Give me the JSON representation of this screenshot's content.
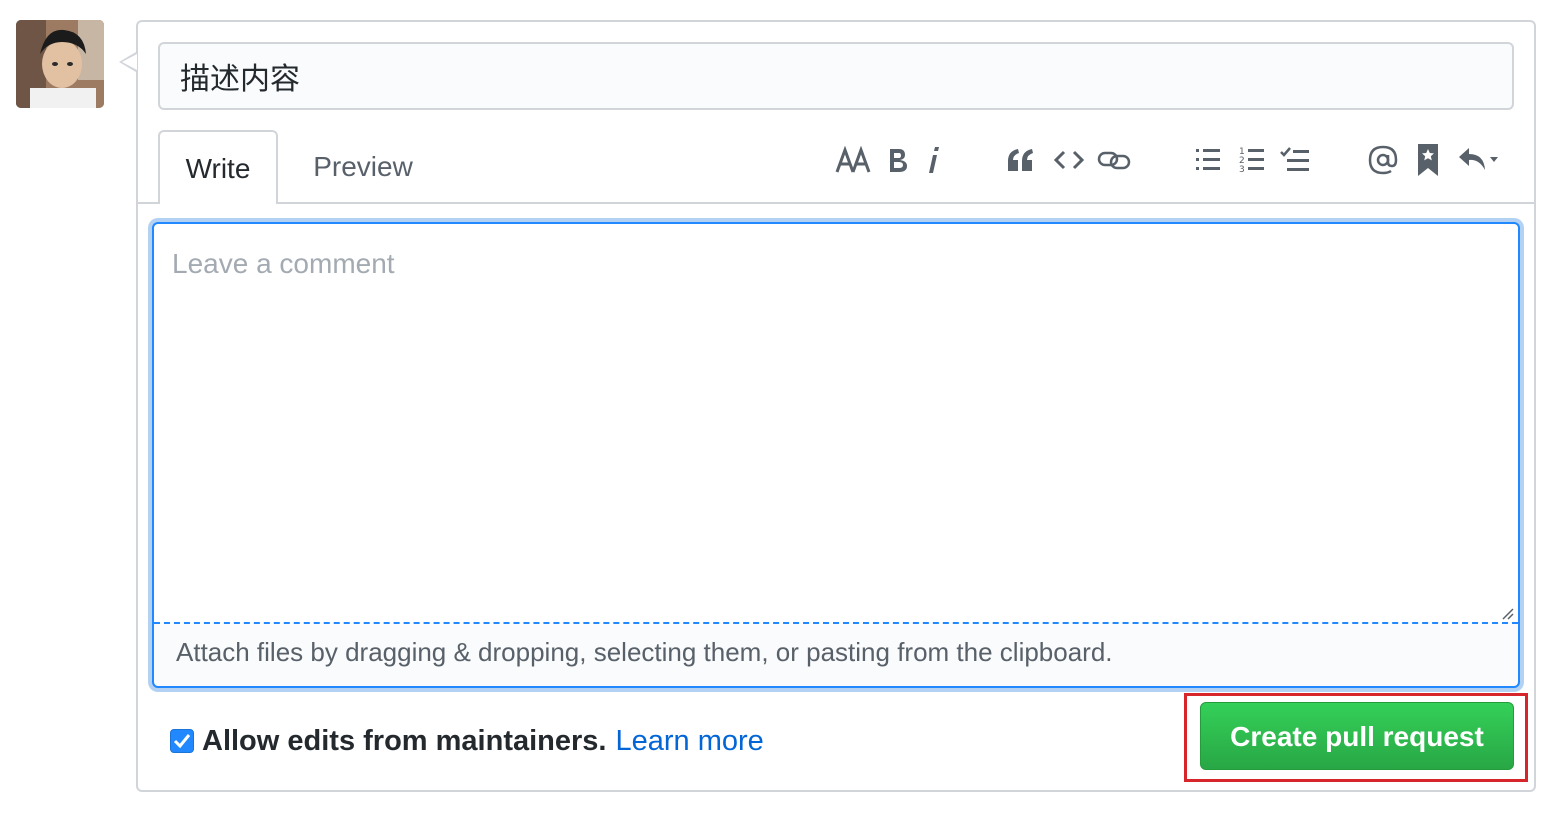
{
  "title_input": {
    "value": "描述内容"
  },
  "tabs": [
    {
      "label": "Write",
      "active": true
    },
    {
      "label": "Preview",
      "active": false
    }
  ],
  "toolbar": {
    "icons": [
      "text-size-icon",
      "bold-icon",
      "italic-icon",
      "quote-icon",
      "code-icon",
      "link-icon",
      "unordered-list-icon",
      "ordered-list-icon",
      "task-list-icon",
      "mention-icon",
      "saved-reply-icon",
      "reply-icon"
    ]
  },
  "comment": {
    "placeholder": "Leave a comment",
    "value": "",
    "attach_text": "Attach files by dragging & dropping, selecting them, or pasting from the clipboard."
  },
  "allow_edits": {
    "checked": true,
    "label": "Allow edits from maintainers.",
    "link": "Learn more"
  },
  "create_button": {
    "label": "Create pull request"
  },
  "colors": {
    "accent": "#2188ff",
    "link": "#0366d6",
    "button_green": "#2ea44f",
    "highlight_red": "#d7262b"
  }
}
